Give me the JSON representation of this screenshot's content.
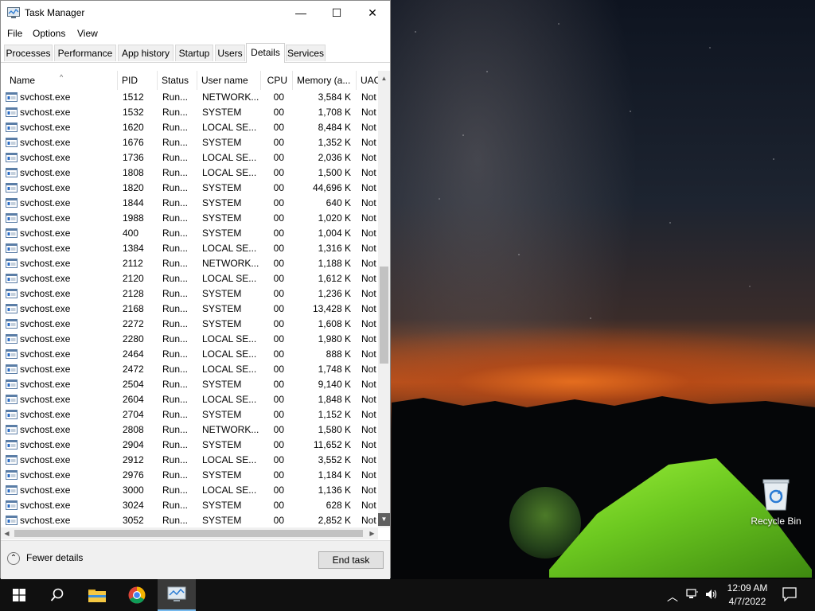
{
  "window": {
    "title": "Task Manager",
    "minimize": "—",
    "maximize": "☐",
    "close": "✕"
  },
  "menu": [
    "File",
    "Options",
    "View"
  ],
  "tabs": [
    "Processes",
    "Performance",
    "App history",
    "Startup",
    "Users",
    "Details",
    "Services"
  ],
  "active_tab": "Details",
  "columns": [
    "Name",
    "PID",
    "Status",
    "User name",
    "CPU",
    "Memory (a...",
    "UAC"
  ],
  "rows": [
    [
      "svchost.exe",
      "1512",
      "Run...",
      "NETWORK...",
      "00",
      "3,584 K",
      "Not"
    ],
    [
      "svchost.exe",
      "1532",
      "Run...",
      "SYSTEM",
      "00",
      "1,708 K",
      "Not"
    ],
    [
      "svchost.exe",
      "1620",
      "Run...",
      "LOCAL SE...",
      "00",
      "8,484 K",
      "Not"
    ],
    [
      "svchost.exe",
      "1676",
      "Run...",
      "SYSTEM",
      "00",
      "1,352 K",
      "Not"
    ],
    [
      "svchost.exe",
      "1736",
      "Run...",
      "LOCAL SE...",
      "00",
      "2,036 K",
      "Not"
    ],
    [
      "svchost.exe",
      "1808",
      "Run...",
      "LOCAL SE...",
      "00",
      "1,500 K",
      "Not"
    ],
    [
      "svchost.exe",
      "1820",
      "Run...",
      "SYSTEM",
      "00",
      "44,696 K",
      "Not"
    ],
    [
      "svchost.exe",
      "1844",
      "Run...",
      "SYSTEM",
      "00",
      "640 K",
      "Not"
    ],
    [
      "svchost.exe",
      "1988",
      "Run...",
      "SYSTEM",
      "00",
      "1,020 K",
      "Not"
    ],
    [
      "svchost.exe",
      "400",
      "Run...",
      "SYSTEM",
      "00",
      "1,004 K",
      "Not"
    ],
    [
      "svchost.exe",
      "1384",
      "Run...",
      "LOCAL SE...",
      "00",
      "1,316 K",
      "Not"
    ],
    [
      "svchost.exe",
      "2112",
      "Run...",
      "NETWORK...",
      "00",
      "1,188 K",
      "Not"
    ],
    [
      "svchost.exe",
      "2120",
      "Run...",
      "LOCAL SE...",
      "00",
      "1,612 K",
      "Not"
    ],
    [
      "svchost.exe",
      "2128",
      "Run...",
      "SYSTEM",
      "00",
      "1,236 K",
      "Not"
    ],
    [
      "svchost.exe",
      "2168",
      "Run...",
      "SYSTEM",
      "00",
      "13,428 K",
      "Not"
    ],
    [
      "svchost.exe",
      "2272",
      "Run...",
      "SYSTEM",
      "00",
      "1,608 K",
      "Not"
    ],
    [
      "svchost.exe",
      "2280",
      "Run...",
      "LOCAL SE...",
      "00",
      "1,980 K",
      "Not"
    ],
    [
      "svchost.exe",
      "2464",
      "Run...",
      "LOCAL SE...",
      "00",
      "888 K",
      "Not"
    ],
    [
      "svchost.exe",
      "2472",
      "Run...",
      "LOCAL SE...",
      "00",
      "1,748 K",
      "Not"
    ],
    [
      "svchost.exe",
      "2504",
      "Run...",
      "SYSTEM",
      "00",
      "9,140 K",
      "Not"
    ],
    [
      "svchost.exe",
      "2604",
      "Run...",
      "LOCAL SE...",
      "00",
      "1,848 K",
      "Not"
    ],
    [
      "svchost.exe",
      "2704",
      "Run...",
      "SYSTEM",
      "00",
      "1,152 K",
      "Not"
    ],
    [
      "svchost.exe",
      "2808",
      "Run...",
      "NETWORK...",
      "00",
      "1,580 K",
      "Not"
    ],
    [
      "svchost.exe",
      "2904",
      "Run...",
      "SYSTEM",
      "00",
      "11,652 K",
      "Not"
    ],
    [
      "svchost.exe",
      "2912",
      "Run...",
      "LOCAL SE...",
      "00",
      "3,552 K",
      "Not"
    ],
    [
      "svchost.exe",
      "2976",
      "Run...",
      "SYSTEM",
      "00",
      "1,184 K",
      "Not"
    ],
    [
      "svchost.exe",
      "3000",
      "Run...",
      "LOCAL SE...",
      "00",
      "1,136 K",
      "Not"
    ],
    [
      "svchost.exe",
      "3024",
      "Run...",
      "SYSTEM",
      "00",
      "628 K",
      "Not"
    ],
    [
      "svchost.exe",
      "3052",
      "Run...",
      "SYSTEM",
      "00",
      "2,852 K",
      "Not"
    ]
  ],
  "footer": {
    "fewer_details": "Fewer details",
    "end_task": "End task"
  },
  "desktop": {
    "recycle_bin_label": "Recycle Bin"
  },
  "taskbar": {
    "apps": [
      "windows-start-icon",
      "search-icon",
      "file-explorer-icon",
      "chrome-icon",
      "task-manager-icon"
    ],
    "active_app": "task-manager-icon",
    "clock_time": "12:09 AM",
    "clock_date": "4/7/2022"
  },
  "colors": {
    "taskbar_bg": "#101010",
    "tent_green": "#7ddc2c",
    "active_indicator": "#76b9ed"
  }
}
